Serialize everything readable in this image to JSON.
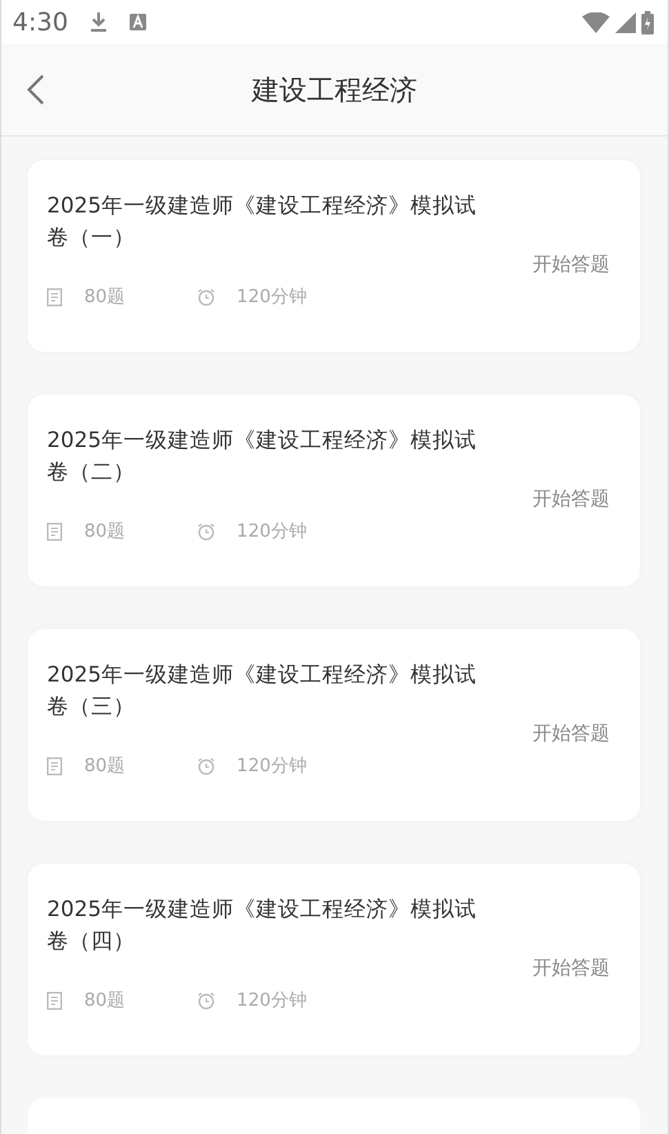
{
  "status_bar": {
    "time": "4:30"
  },
  "header": {
    "title": "建设工程经济"
  },
  "exams": [
    {
      "title": "2025年一级建造师《建设工程经济》模拟试卷（一）",
      "questions": "80题",
      "duration": "120分钟",
      "action": "开始答题"
    },
    {
      "title": "2025年一级建造师《建设工程经济》模拟试卷（二）",
      "questions": "80题",
      "duration": "120分钟",
      "action": "开始答题"
    },
    {
      "title": "2025年一级建造师《建设工程经济》模拟试卷（三）",
      "questions": "80题",
      "duration": "120分钟",
      "action": "开始答题"
    },
    {
      "title": "2025年一级建造师《建设工程经济》模拟试卷（四）",
      "questions": "80题",
      "duration": "120分钟",
      "action": "开始答题"
    }
  ]
}
